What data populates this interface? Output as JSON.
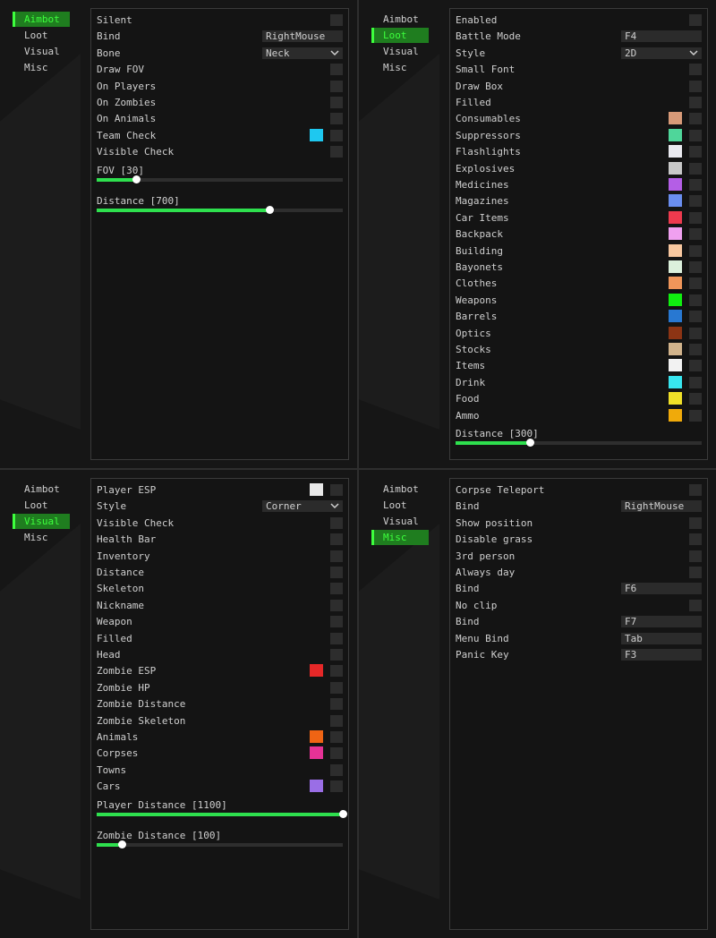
{
  "colors": {
    "accent": "#3dff3d",
    "tab_active_bg": "#1f7d1f",
    "slider_fill": "#2ee04e",
    "checkbox_bg": "#2d2d2d",
    "panel_border": "#3a3a3a",
    "background": "#161616"
  },
  "tabs": [
    "Aimbot",
    "Loot",
    "Visual",
    "Misc"
  ],
  "icons": {
    "dropdown": "chevron-down-icon"
  },
  "aimbot": {
    "rows": [
      {
        "type": "checkbox",
        "label": "Silent"
      },
      {
        "type": "field",
        "label": "Bind",
        "value": "RightMouse"
      },
      {
        "type": "select",
        "label": "Bone",
        "value": "Neck"
      },
      {
        "type": "checkbox",
        "label": "Draw FOV"
      },
      {
        "type": "checkbox",
        "label": "On Players"
      },
      {
        "type": "checkbox",
        "label": "On Zombies"
      },
      {
        "type": "checkbox",
        "label": "On Animals"
      },
      {
        "type": "checkbox",
        "label": "Team Check",
        "color": "#1ec8f0"
      },
      {
        "type": "checkbox",
        "label": "Visible Check"
      }
    ],
    "sliders": [
      {
        "label": "FOV [30]",
        "fraction": 0.16
      },
      {
        "label": "Distance [700]",
        "fraction": 0.7
      }
    ]
  },
  "loot": {
    "rows": [
      {
        "type": "checkbox",
        "label": "Enabled"
      },
      {
        "type": "field",
        "label": "Battle Mode",
        "value": "F4"
      },
      {
        "type": "select",
        "label": "Style",
        "value": "2D"
      },
      {
        "type": "checkbox",
        "label": "Small Font"
      },
      {
        "type": "checkbox",
        "label": "Draw Box"
      },
      {
        "type": "checkbox",
        "label": "Filled"
      },
      {
        "type": "checkbox",
        "label": "Consumables",
        "color": "#d89a78"
      },
      {
        "type": "checkbox",
        "label": "Suppressors",
        "color": "#4fd69a"
      },
      {
        "type": "checkbox",
        "label": "Flashlights",
        "color": "#eaeaf0"
      },
      {
        "type": "checkbox",
        "label": "Explosives",
        "color": "#c8c8c8"
      },
      {
        "type": "checkbox",
        "label": "Medicines",
        "color": "#b45ee6"
      },
      {
        "type": "checkbox",
        "label": "Magazines",
        "color": "#6a8ef0"
      },
      {
        "type": "checkbox",
        "label": "Car Items",
        "color": "#ee3a4e"
      },
      {
        "type": "checkbox",
        "label": "Backpack",
        "color": "#f0a0f0"
      },
      {
        "type": "checkbox",
        "label": "Building",
        "color": "#f8c8a0"
      },
      {
        "type": "checkbox",
        "label": "Bayonets",
        "color": "#dcf0dc"
      },
      {
        "type": "checkbox",
        "label": "Clothes",
        "color": "#f0965a"
      },
      {
        "type": "checkbox",
        "label": "Weapons",
        "color": "#10f010"
      },
      {
        "type": "checkbox",
        "label": "Barrels",
        "color": "#2878d2"
      },
      {
        "type": "checkbox",
        "label": "Optics",
        "color": "#8c3414"
      },
      {
        "type": "checkbox",
        "label": "Stocks",
        "color": "#d2b48c"
      },
      {
        "type": "checkbox",
        "label": "Items",
        "color": "#f2f2f2"
      },
      {
        "type": "checkbox",
        "label": "Drink",
        "color": "#38e6f0"
      },
      {
        "type": "checkbox",
        "label": "Food",
        "color": "#f0e028"
      },
      {
        "type": "checkbox",
        "label": "Ammo",
        "color": "#f0aa0a"
      }
    ],
    "sliders": [
      {
        "label": "Distance [300]",
        "fraction": 0.3
      }
    ]
  },
  "visual": {
    "rows": [
      {
        "type": "checkbox",
        "label": "Player ESP",
        "color": "#e8e8e8"
      },
      {
        "type": "select",
        "label": "Style",
        "value": "Corner"
      },
      {
        "type": "checkbox",
        "label": "Visible Check"
      },
      {
        "type": "checkbox",
        "label": "Health Bar"
      },
      {
        "type": "checkbox",
        "label": "Inventory"
      },
      {
        "type": "checkbox",
        "label": "Distance"
      },
      {
        "type": "checkbox",
        "label": "Skeleton"
      },
      {
        "type": "checkbox",
        "label": "Nickname"
      },
      {
        "type": "checkbox",
        "label": "Weapon"
      },
      {
        "type": "checkbox",
        "label": "Filled"
      },
      {
        "type": "checkbox",
        "label": "Head"
      },
      {
        "type": "checkbox",
        "label": "Zombie ESP",
        "color": "#e62828"
      },
      {
        "type": "checkbox",
        "label": "Zombie HP"
      },
      {
        "type": "checkbox",
        "label": "Zombie Distance"
      },
      {
        "type": "checkbox",
        "label": "Zombie Skeleton"
      },
      {
        "type": "checkbox",
        "label": "Animals",
        "color": "#f06414"
      },
      {
        "type": "checkbox",
        "label": "Corpses",
        "color": "#e63296"
      },
      {
        "type": "checkbox",
        "label": "Towns"
      },
      {
        "type": "checkbox",
        "label": "Cars",
        "color": "#9a6ee6"
      }
    ],
    "sliders": [
      {
        "label": "Player Distance [1100]",
        "fraction": 1.0
      },
      {
        "label": "Zombie Distance [100]",
        "fraction": 0.1
      }
    ]
  },
  "misc": {
    "rows": [
      {
        "type": "checkbox",
        "label": "Corpse Teleport"
      },
      {
        "type": "field",
        "label": "Bind",
        "value": "RightMouse"
      },
      {
        "type": "checkbox",
        "label": "Show position"
      },
      {
        "type": "checkbox",
        "label": "Disable grass"
      },
      {
        "type": "checkbox",
        "label": "3rd person"
      },
      {
        "type": "checkbox",
        "label": "Always day"
      },
      {
        "type": "field",
        "label": "Bind",
        "value": "F6"
      },
      {
        "type": "checkbox",
        "label": "No clip"
      },
      {
        "type": "field",
        "label": "Bind",
        "value": "F7"
      },
      {
        "type": "field",
        "label": "Menu Bind",
        "value": "Tab"
      },
      {
        "type": "field",
        "label": "Panic Key",
        "value": "F3"
      }
    ],
    "sliders": []
  }
}
